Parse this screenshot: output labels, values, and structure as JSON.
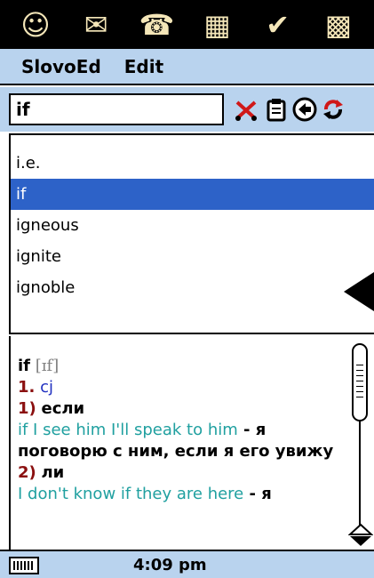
{
  "launcher": {
    "apps": [
      {
        "icon": "contacts-app-icon"
      },
      {
        "icon": "mail-app-icon"
      },
      {
        "icon": "phone-app-icon"
      },
      {
        "icon": "calculator-app-icon"
      },
      {
        "icon": "tasks-app-icon"
      },
      {
        "icon": "calendar-app-icon"
      }
    ]
  },
  "menubar": {
    "app_menu": "SlovoEd",
    "edit_menu": "Edit"
  },
  "search": {
    "value": "if"
  },
  "toolbar": {
    "icons": [
      "cut-icon",
      "paste-icon",
      "back-icon",
      "refresh-icon"
    ]
  },
  "wordlist": {
    "items": [
      {
        "label": "i.e.",
        "selected": false
      },
      {
        "label": "if",
        "selected": true
      },
      {
        "label": "igneous",
        "selected": false
      },
      {
        "label": "ignite",
        "selected": false
      },
      {
        "label": "ignoble",
        "selected": false
      }
    ]
  },
  "article": {
    "headword": "if",
    "transcription": "[ɪf]",
    "sense1_num": "1.",
    "sense1_pos": "cj",
    "sub1_num": "1)",
    "sub1_trans": "если",
    "ex1_en": "if I see him I'll speak to him",
    "ex1_dash": " - ",
    "ex1_ru": "я поговорю с ним, если я его увижу",
    "sub2_num": "2)",
    "sub2_trans": "ли",
    "ex2_en": "I don't know if they are here",
    "ex2_dash": " - ",
    "ex2_ru": "я"
  },
  "status": {
    "time": "4:09 pm"
  },
  "colors": {
    "bar_bg": "#b9d3ee",
    "selection": "#2d62c8",
    "example": "#20a0a0",
    "number": "#8b1010",
    "pos": "#2030c0"
  }
}
